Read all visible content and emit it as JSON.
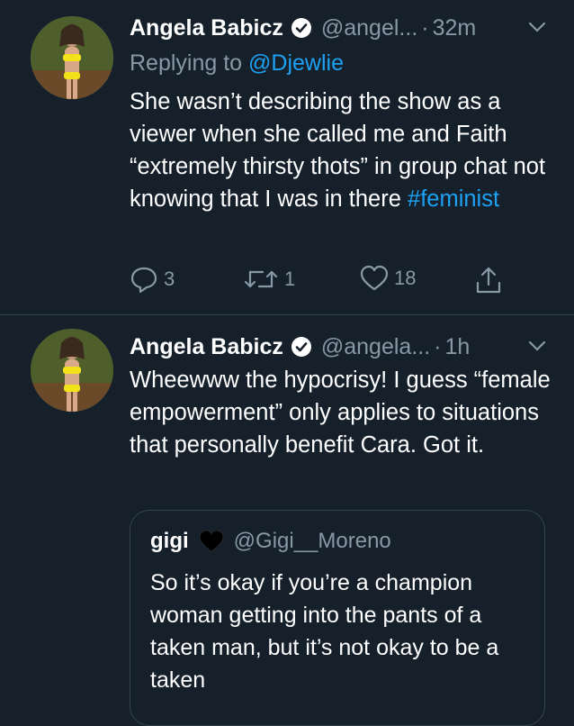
{
  "colors": {
    "background": "#15202b",
    "text": "#ffffff",
    "secondary": "#8899a6",
    "link": "#1da1f2",
    "divider": "#38444d"
  },
  "tweet1": {
    "author_name": "Angela Babicz",
    "author_handle": "@angel...",
    "separator": "·",
    "time": "32m",
    "replying_prefix": "Replying to",
    "replying_to": "@Djewlie",
    "text_main": "She wasn’t describing the show as a viewer when she called me and Faith “extremely thirsty thots” in group chat not knowing that I was in there ",
    "hashtag": "#feminist",
    "replies": "3",
    "retweets": "1",
    "likes": "18",
    "icons": [
      "verified-icon",
      "chevron-down-icon",
      "reply-icon",
      "retweet-icon",
      "like-icon",
      "share-icon"
    ]
  },
  "tweet2": {
    "author_name": "Angela Babicz",
    "author_handle": "@angela...",
    "separator": "·",
    "time": "1h",
    "text": "Wheewww the hypocrisy! I guess “female empowerment” only applies to situations that personally benefit Cara. Got it.",
    "quote": {
      "author_name": "gigi",
      "author_handle": "@Gigi__Moreno",
      "text": "So it’s okay if you’re a champion woman getting into the pants of a taken man, but it’s not okay to be a taken"
    }
  }
}
